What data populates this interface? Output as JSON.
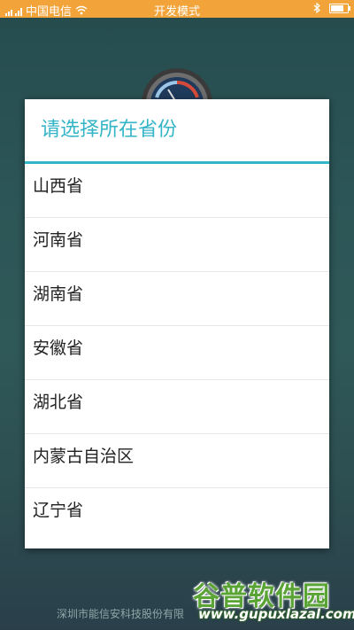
{
  "status_bar": {
    "carrier": "中国电信",
    "mode": "开发模式",
    "icons": [
      "signal-icon",
      "wifi-icon",
      "bluetooth-icon",
      "battery-icon"
    ],
    "background": "#f2a43a"
  },
  "dialog": {
    "title": "请选择所在省份",
    "accent_color": "#33b5c7",
    "options": [
      "山西省",
      "河南省",
      "湖南省",
      "安徽省",
      "湖北省",
      "内蒙古自治区",
      "辽宁省"
    ]
  },
  "footer": {
    "company": "深圳市能信安科技股份有限"
  },
  "watermark": {
    "logo": "谷普软件园",
    "url": "www.gupuxlazal.com"
  }
}
